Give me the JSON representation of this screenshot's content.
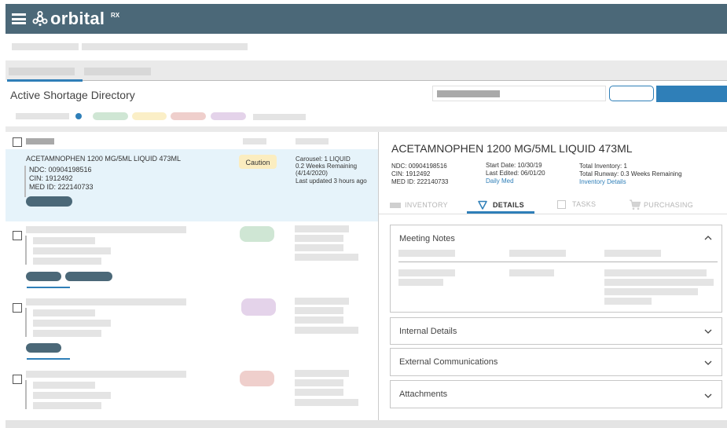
{
  "app": {
    "brand": "orbital",
    "brand_suffix": "RX"
  },
  "page": {
    "title": "Active Shortage Directory"
  },
  "selected_item": {
    "name": "ACETAMNOPHEN 1200 MG/5ML LIQUID 473ML",
    "ndc": "NDC: 00904198516",
    "cin": "CIN: 1912492",
    "med_id": "MED ID: 222140733",
    "badge": "Caution",
    "carousel": "Carousel: 1 LIQUID",
    "weeks": "0.2 Weeks Remaining",
    "date": "(4/14/2020)",
    "updated": "Last updated 3 hours ago"
  },
  "detail": {
    "title": "ACETAMNOPHEN 1200 MG/5ML LIQUID 473ML",
    "ndc": "NDC: 00904198516",
    "cin": "CIN: 1912492",
    "med_id": "MED ID: 222140733",
    "start_date": "Start Date: 10/30/19",
    "last_edited": "Last Edited: 06/01/20",
    "daily_med": "Daily Med",
    "total_inventory": "Total Inventory: 1",
    "total_runway": "Total Runway: 0.3 Weeks Remaining",
    "inventory_details": "Inventory Details",
    "tabs": [
      "INVENTORY",
      "DETAILS",
      "TASKS",
      "PURCHASING"
    ],
    "active_tab": "DETAILS",
    "sections": {
      "meeting_notes": "Meeting Notes",
      "internal_details": "Internal Details",
      "external_communications": "External Communications",
      "attachments": "Attachments"
    }
  },
  "colors": {
    "header": "#4b6878",
    "accent": "#2f7fb8",
    "selected_row": "#e6f3fa",
    "caution_badge": "#fbedc0",
    "pill_green": "#cfe6d4",
    "pill_yellow": "#fbefc7",
    "pill_red": "#efcfcc",
    "pill_purple": "#e4d3ea"
  }
}
